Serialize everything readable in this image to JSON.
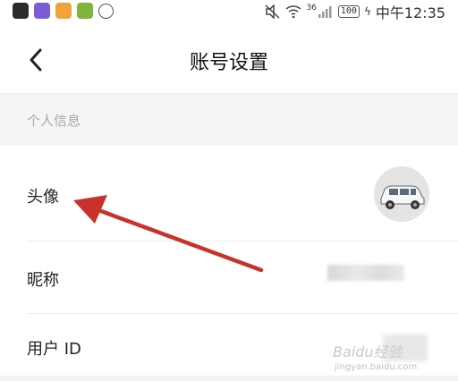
{
  "status_bar": {
    "time": "中午12:35",
    "battery": "100",
    "network": "36"
  },
  "header": {
    "back_icon": "chevron-left-icon",
    "title": "账号设置"
  },
  "section": {
    "label": "个人信息"
  },
  "rows": [
    {
      "label": "头像",
      "value_type": "avatar"
    },
    {
      "label": "昵称",
      "value_type": "blurred-text"
    },
    {
      "label": "用户 ID",
      "value_type": "blurred-text"
    }
  ],
  "watermark": {
    "text": "Baidu经验",
    "url": "jingyan.baidu.com"
  },
  "colors": {
    "arrow": "#c8322b",
    "section_bg": "#f5f5f7",
    "section_text": "#aaaaaa"
  }
}
